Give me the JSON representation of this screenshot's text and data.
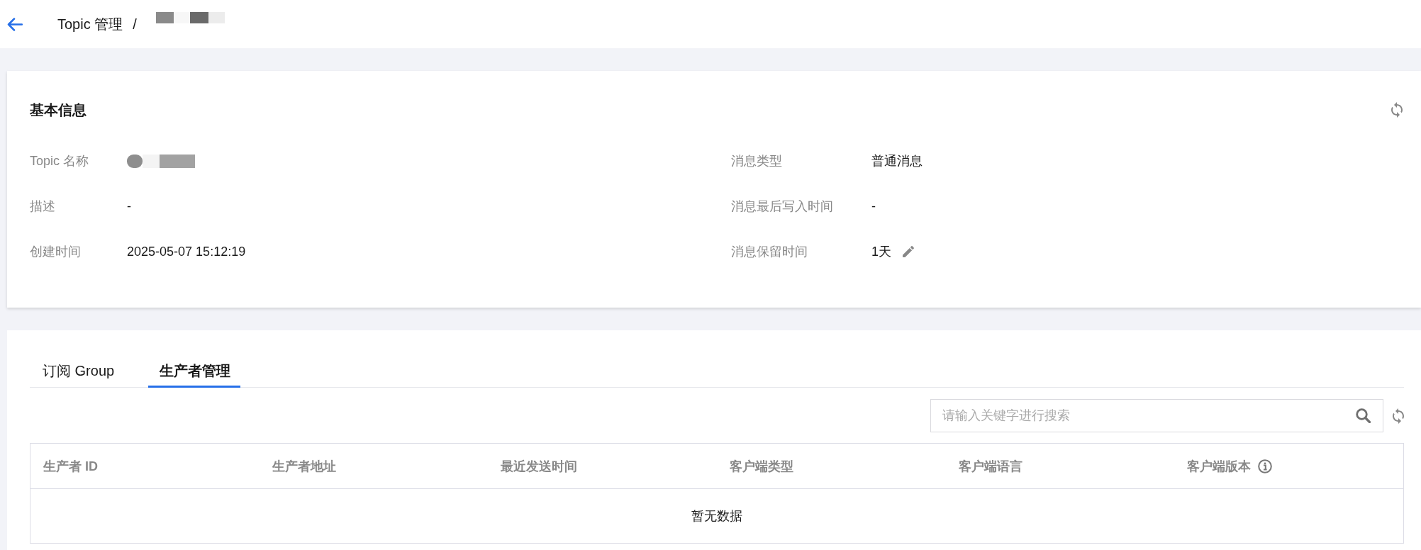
{
  "header": {
    "breadcrumb": "Topic 管理",
    "separator": "/"
  },
  "basic_info": {
    "title": "基本信息",
    "columns": [
      {
        "fields": [
          {
            "kind": "redacted",
            "label": "Topic 名称"
          },
          {
            "kind": "text",
            "label": "描述",
            "value": "-"
          },
          {
            "kind": "text",
            "label": "创建时间",
            "value": "2025-05-07 15:12:19"
          }
        ]
      },
      {
        "fields": [
          {
            "kind": "text",
            "label": "消息类型",
            "value": "普通消息"
          },
          {
            "kind": "text",
            "label": "消息最后写入时间",
            "value": "-"
          },
          {
            "kind": "editable",
            "label": "消息保留时间",
            "value": "1天"
          }
        ]
      }
    ]
  },
  "tabs": [
    {
      "label": "订阅 Group",
      "selected": false
    },
    {
      "label": "生产者管理",
      "selected": true
    }
  ],
  "search": {
    "placeholder": "请输入关键字进行搜索"
  },
  "table": {
    "columns": [
      {
        "label": "生产者 ID",
        "info": false
      },
      {
        "label": "生产者地址",
        "info": false
      },
      {
        "label": "最近发送时间",
        "info": false
      },
      {
        "label": "客户端类型",
        "info": false
      },
      {
        "label": "客户端语言",
        "info": false
      },
      {
        "label": "客户端版本",
        "info": true
      }
    ],
    "empty_text": "暂无数据"
  }
}
